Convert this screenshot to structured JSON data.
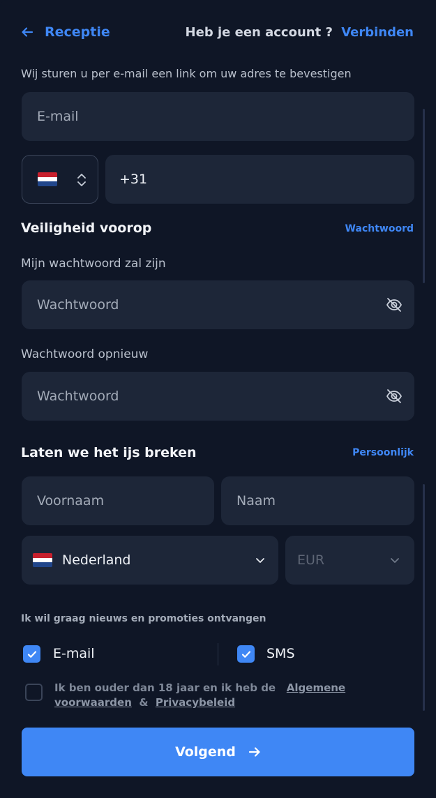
{
  "header": {
    "back_label": "Receptie",
    "account_question": "Heb je een account ?",
    "login_link": "Verbinden"
  },
  "email_info": "Wij sturen u per e-mail een link om uw adres te bevestigen",
  "email_field": {
    "placeholder": "E-mail"
  },
  "phone": {
    "country_flag": "netherlands-flag",
    "prefix": "+31"
  },
  "security": {
    "title": "Veiligheid voorop",
    "link": "Wachtwoord",
    "password_label": "Mijn wachtwoord zal zijn",
    "password_placeholder": "Wachtwoord",
    "repeat_label": "Wachtwoord opnieuw",
    "repeat_placeholder": "Wachtwoord"
  },
  "personal": {
    "title": "Laten we het ijs breken",
    "link": "Persoonlijk",
    "first_name_placeholder": "Voornaam",
    "last_name_placeholder": "Naam",
    "country": "Nederland",
    "currency": "EUR"
  },
  "promotions": {
    "label": "Ik wil graag nieuws en promoties ontvangen",
    "email_option": {
      "label": "E-mail",
      "checked": true
    },
    "sms_option": {
      "label": "SMS",
      "checked": true
    }
  },
  "terms": {
    "checked": false,
    "text": "Ik ben ouder dan 18 jaar en ik heb de",
    "terms_link": "Algemene voorwaarden",
    "connector": "&",
    "privacy_link": "Privacybeleid"
  },
  "submit": {
    "label": "Volgend"
  },
  "colors": {
    "accent": "#3f87f5",
    "background": "#0f1626",
    "field": "#1d2638"
  }
}
